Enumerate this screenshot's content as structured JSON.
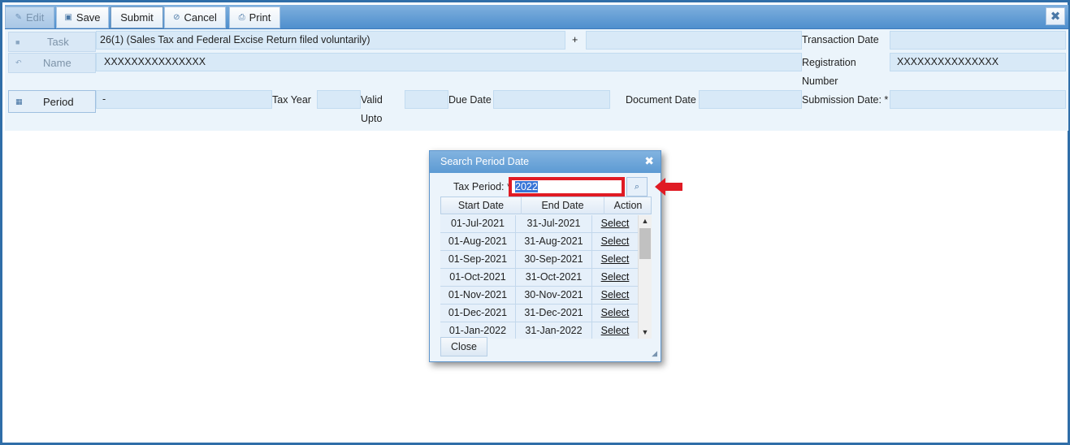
{
  "toolbar": {
    "edit_label": "Edit",
    "save_label": "Save",
    "submit_label": "Submit",
    "cancel_label": "Cancel",
    "print_label": "Print"
  },
  "form": {
    "task_label": "Task",
    "task_value": "26(1) (Sales Tax and Federal Excise Return filed voluntarily)",
    "plus_label": "+",
    "name_label": "Name",
    "name_value": "XXXXXXXXXXXXXXX",
    "transaction_date_label": "Transaction Date",
    "transaction_date_value": "",
    "registration_number_label_1": "Registration",
    "registration_number_label_2": "Number",
    "registration_number_value": "XXXXXXXXXXXXXXX",
    "period_label": "Period",
    "period_value": "-",
    "tax_year_label": "Tax Year",
    "tax_year_value": "",
    "valid_upto_label_1": "Valid",
    "valid_upto_label_2": "Upto",
    "valid_upto_value": "",
    "due_date_label": "Due Date",
    "due_date_value": "",
    "document_date_label": "Document Date",
    "document_date_value": "",
    "submission_date_label": "Submission Date: *",
    "submission_date_value": ""
  },
  "dialog": {
    "title": "Search Period Date",
    "tax_period_label": "Tax Period: *",
    "tax_period_value": "2022",
    "columns": [
      "Start Date",
      "End Date",
      "Action"
    ],
    "rows": [
      {
        "start": "01-Jul-2021",
        "end": "31-Jul-2021",
        "action": "Select"
      },
      {
        "start": "01-Aug-2021",
        "end": "31-Aug-2021",
        "action": "Select"
      },
      {
        "start": "01-Sep-2021",
        "end": "30-Sep-2021",
        "action": "Select"
      },
      {
        "start": "01-Oct-2021",
        "end": "31-Oct-2021",
        "action": "Select"
      },
      {
        "start": "01-Nov-2021",
        "end": "30-Nov-2021",
        "action": "Select"
      },
      {
        "start": "01-Dec-2021",
        "end": "31-Dec-2021",
        "action": "Select"
      },
      {
        "start": "01-Jan-2022",
        "end": "31-Jan-2022",
        "action": "Select"
      }
    ],
    "close_label": "Close"
  },
  "colors": {
    "toolbar": "#5c9ad3",
    "field": "#d8e9f7",
    "highlight_box": "#e01b24"
  }
}
